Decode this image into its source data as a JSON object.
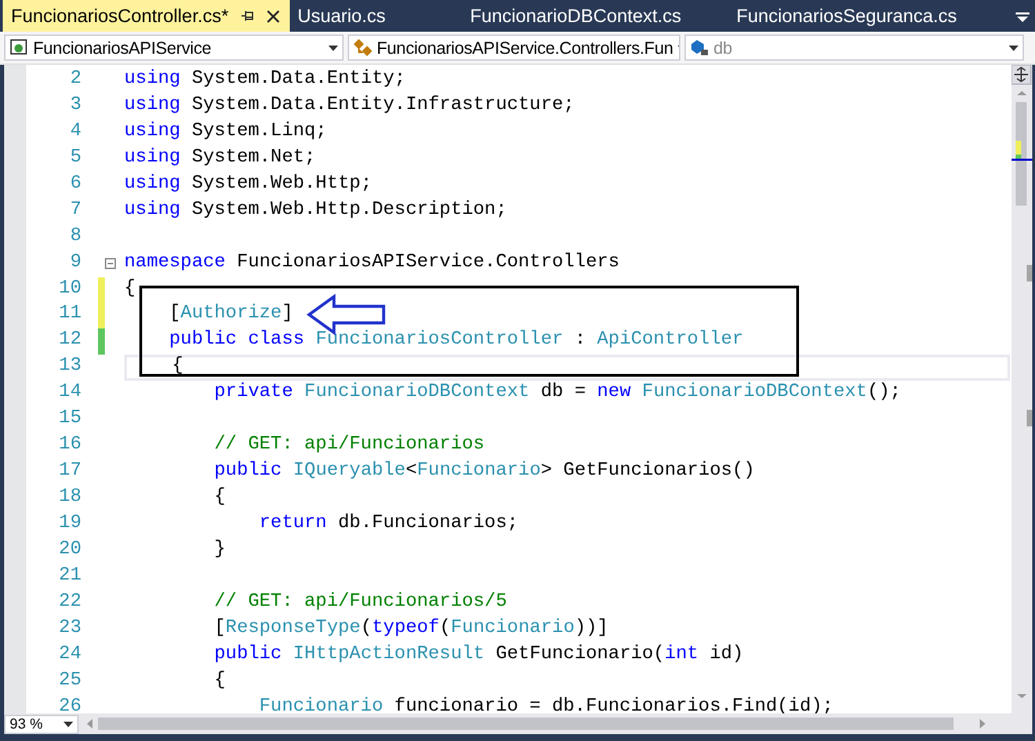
{
  "tabs": [
    {
      "label": "FuncionariosController.cs*",
      "selected": true
    },
    {
      "label": "Usuario.cs",
      "selected": false
    },
    {
      "label": "FuncionarioDBContext.cs",
      "selected": false
    },
    {
      "label": "FuncionariosSeguranca.cs",
      "selected": false
    }
  ],
  "navigation": [
    {
      "kind": "project",
      "label": "FuncionariosAPIService"
    },
    {
      "kind": "class",
      "label": "FuncionariosAPIService.Controllers.Fun"
    },
    {
      "kind": "member",
      "label": "db"
    }
  ],
  "lines": [
    {
      "number": "2",
      "modified": false,
      "saved": false,
      "current": false,
      "collapsible": false,
      "tokens": [
        {
          "kind": "keyword",
          "text": "using "
        },
        {
          "kind": "plain",
          "text": "System.Data.Entity;"
        }
      ]
    },
    {
      "number": "3",
      "modified": false,
      "saved": false,
      "current": false,
      "collapsible": false,
      "tokens": [
        {
          "kind": "keyword",
          "text": "using "
        },
        {
          "kind": "plain",
          "text": "System.Data.Entity.Infrastructure;"
        }
      ]
    },
    {
      "number": "4",
      "modified": false,
      "saved": false,
      "current": false,
      "collapsible": false,
      "tokens": [
        {
          "kind": "keyword",
          "text": "using "
        },
        {
          "kind": "plain",
          "text": "System.Linq;"
        }
      ]
    },
    {
      "number": "5",
      "modified": false,
      "saved": false,
      "current": false,
      "collapsible": false,
      "tokens": [
        {
          "kind": "keyword",
          "text": "using "
        },
        {
          "kind": "plain",
          "text": "System.Net;"
        }
      ]
    },
    {
      "number": "6",
      "modified": false,
      "saved": false,
      "current": false,
      "collapsible": false,
      "tokens": [
        {
          "kind": "keyword",
          "text": "using "
        },
        {
          "kind": "plain",
          "text": "System.Web.Http;"
        }
      ]
    },
    {
      "number": "7",
      "modified": false,
      "saved": false,
      "current": false,
      "collapsible": false,
      "tokens": [
        {
          "kind": "keyword",
          "text": "using "
        },
        {
          "kind": "plain",
          "text": "System.Web.Http.Description;"
        }
      ]
    },
    {
      "number": "8",
      "modified": false,
      "saved": false,
      "current": false,
      "collapsible": false
    },
    {
      "number": "9",
      "modified": false,
      "saved": false,
      "current": false,
      "collapsible": true,
      "tokens": [
        {
          "kind": "keyword",
          "text": "namespace "
        },
        {
          "kind": "plain",
          "text": "FuncionariosAPIService.Controllers"
        }
      ]
    },
    {
      "number": "10",
      "modified": true,
      "saved": false,
      "current": false,
      "collapsible": false,
      "tokens": [
        {
          "kind": "plain",
          "text": "{"
        }
      ]
    },
    {
      "number": "11",
      "modified": true,
      "saved": false,
      "current": false,
      "collapsible": false,
      "tokens": [
        {
          "kind": "plain",
          "text": "    ["
        },
        {
          "kind": "type",
          "text": "Authorize"
        },
        {
          "kind": "plain",
          "text": "]"
        }
      ]
    },
    {
      "number": "12",
      "modified": true,
      "saved": true,
      "current": false,
      "collapsible": false,
      "tokens": [
        {
          "kind": "keyword",
          "text": "    public class "
        },
        {
          "kind": "type",
          "text": "FuncionariosController"
        },
        {
          "kind": "plain",
          "text": " : "
        },
        {
          "kind": "type",
          "text": "ApiController"
        }
      ]
    },
    {
      "number": "13",
      "modified": false,
      "saved": false,
      "current": true,
      "collapsible": false,
      "tokens": [
        {
          "kind": "plain",
          "text": "    {"
        }
      ]
    },
    {
      "number": "14",
      "modified": false,
      "saved": false,
      "current": false,
      "collapsible": false,
      "tokens": [
        {
          "kind": "keyword",
          "text": "        private "
        },
        {
          "kind": "type",
          "text": "FuncionarioDBContext"
        },
        {
          "kind": "plain",
          "text": " db = "
        },
        {
          "kind": "keyword",
          "text": "new "
        },
        {
          "kind": "type",
          "text": "FuncionarioDBContext"
        },
        {
          "kind": "plain",
          "text": "();"
        }
      ]
    },
    {
      "number": "15",
      "modified": false,
      "saved": false,
      "current": false,
      "collapsible": false
    },
    {
      "number": "16",
      "modified": false,
      "saved": false,
      "current": false,
      "collapsible": false,
      "tokens": [
        {
          "kind": "comment",
          "text": "        // GET: api/Funcionarios"
        }
      ]
    },
    {
      "number": "17",
      "modified": false,
      "saved": false,
      "current": false,
      "collapsible": false,
      "tokens": [
        {
          "kind": "keyword",
          "text": "        public "
        },
        {
          "kind": "type",
          "text": "IQueryable"
        },
        {
          "kind": "plain",
          "text": "<"
        },
        {
          "kind": "type",
          "text": "Funcionario"
        },
        {
          "kind": "plain",
          "text": "> GetFuncionarios()"
        }
      ]
    },
    {
      "number": "18",
      "modified": false,
      "saved": false,
      "current": false,
      "collapsible": false,
      "tokens": [
        {
          "kind": "plain",
          "text": "        {"
        }
      ]
    },
    {
      "number": "19",
      "modified": false,
      "saved": false,
      "current": false,
      "collapsible": false,
      "tokens": [
        {
          "kind": "keyword",
          "text": "            return"
        },
        {
          "kind": "plain",
          "text": " db.Funcionarios;"
        }
      ]
    },
    {
      "number": "20",
      "modified": false,
      "saved": false,
      "current": false,
      "collapsible": false,
      "tokens": [
        {
          "kind": "plain",
          "text": "        }"
        }
      ]
    },
    {
      "number": "21",
      "modified": false,
      "saved": false,
      "current": false,
      "collapsible": false
    },
    {
      "number": "22",
      "modified": false,
      "saved": false,
      "current": false,
      "collapsible": false,
      "tokens": [
        {
          "kind": "comment",
          "text": "        // GET: api/Funcionarios/5"
        }
      ]
    },
    {
      "number": "23",
      "modified": false,
      "saved": false,
      "current": false,
      "collapsible": false,
      "tokens": [
        {
          "kind": "plain",
          "text": "        ["
        },
        {
          "kind": "type",
          "text": "ResponseType"
        },
        {
          "kind": "plain",
          "text": "("
        },
        {
          "kind": "keyword",
          "text": "typeof"
        },
        {
          "kind": "plain",
          "text": "("
        },
        {
          "kind": "type",
          "text": "Funcionario"
        },
        {
          "kind": "plain",
          "text": "))]"
        }
      ]
    },
    {
      "number": "24",
      "modified": false,
      "saved": false,
      "current": false,
      "collapsible": false,
      "tokens": [
        {
          "kind": "keyword",
          "text": "        public "
        },
        {
          "kind": "type",
          "text": "IHttpActionResult"
        },
        {
          "kind": "plain",
          "text": " GetFuncionario("
        },
        {
          "kind": "keyword",
          "text": "int"
        },
        {
          "kind": "plain",
          "text": " id)"
        }
      ]
    },
    {
      "number": "25",
      "modified": false,
      "saved": false,
      "current": false,
      "collapsible": false,
      "tokens": [
        {
          "kind": "plain",
          "text": "        {"
        }
      ]
    },
    {
      "number": "26",
      "modified": false,
      "saved": false,
      "current": false,
      "collapsible": false,
      "tokens": [
        {
          "kind": "type",
          "text": "            Funcionario"
        },
        {
          "kind": "plain",
          "text": " funcionario = db.Funcionarios.Find(id);"
        }
      ]
    }
  ],
  "zoom": {
    "value": "93 %"
  }
}
